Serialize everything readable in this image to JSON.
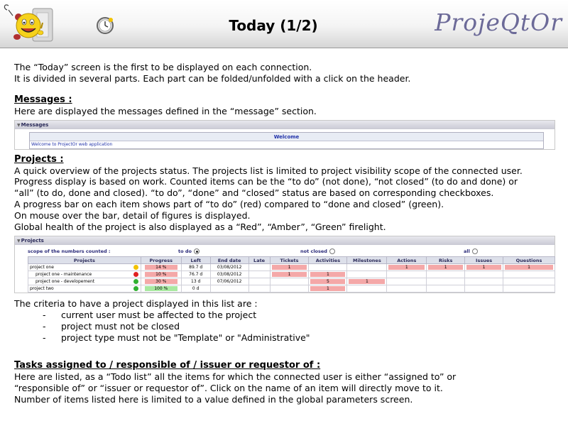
{
  "header": {
    "title": "Today (1/2)",
    "brand": "ProjeQtOr"
  },
  "intro": [
    "The “Today” screen is the first to be displayed on each connection.",
    "It is divided in several parts. Each part can be folded/unfolded with a click on the header."
  ],
  "messages": {
    "title": "Messages :",
    "text": "Here are displayed the messages defined in the “message” section.",
    "panel_header": "Messages",
    "table_header": "Welcome",
    "row": "Welcome to ProjectOr web application"
  },
  "projects": {
    "title": "Projects :",
    "lines": [
      "A quick overview of the projects status. The projects list is limited to project visibility scope of the connected user.",
      "Progress display is based on work. Counted items can be the “to do” (not done), “not closed” (to do and done) or",
      "“all” (to do, done and closed). “to do”, “done” and “closed” status are based on corresponding checkboxes.",
      "A progress bar on each item shows part of “to do” (red) compared to “done and closed” (green).",
      "On mouse over the bar, detail of figures is displayed.",
      "Global health of the project is also displayed as a “Red”, “Amber”, “Green” firelight."
    ],
    "panel_header": "Projects",
    "scope_label": "scope of the numbers counted :",
    "scope_options": [
      "to do",
      "not closed",
      "all"
    ],
    "scope_selected": "to do",
    "columns": [
      "Projects",
      "Progress",
      "Left",
      "End date",
      "Late",
      "Tickets",
      "Activities",
      "Milestones",
      "Actions",
      "Risks",
      "Issues",
      "Questions"
    ],
    "rows": [
      {
        "name": "project one",
        "indent": 0,
        "health": "#f2c200",
        "progress": "14 %",
        "progress_color": "pink",
        "left": "89.7 d",
        "end": "03/08/2012",
        "late": "",
        "tickets": "1",
        "activities": "",
        "milestones": "",
        "actions": "1",
        "risks": "1",
        "issues": "1",
        "questions": "1"
      },
      {
        "name": "project one - maintenance",
        "indent": 1,
        "health": "#e02020",
        "progress": "10 %",
        "progress_color": "pink",
        "left": "76.7 d",
        "end": "03/08/2012",
        "late": "",
        "tickets": "1",
        "activities": "1",
        "milestones": "",
        "actions": "",
        "risks": "",
        "issues": "",
        "questions": ""
      },
      {
        "name": "project one - developement",
        "indent": 1,
        "health": "#30b030",
        "progress": "30 %",
        "progress_color": "pink",
        "left": "13 d",
        "end": "07/06/2012",
        "late": "",
        "tickets": "",
        "activities": "5",
        "milestones": "1",
        "actions": "",
        "risks": "",
        "issues": "",
        "questions": ""
      },
      {
        "name": "project two",
        "indent": 0,
        "health": "#30b030",
        "progress": "100 %",
        "progress_color": "green",
        "left": "0 d",
        "end": "",
        "late": "",
        "tickets": "",
        "activities": "1",
        "milestones": "",
        "actions": "",
        "risks": "",
        "issues": "",
        "questions": ""
      }
    ]
  },
  "criteria": {
    "intro": "The criteria to have a project displayed in this list are :",
    "items": [
      "current user must be affected to the project",
      "project must not be closed",
      "project type must not be \"Template\" or \"Administrative\""
    ]
  },
  "tasks": {
    "title": "Tasks assigned to / responsible of / issuer or requestor of :",
    "lines": [
      "Here are listed, as a “Todo list” all the items for which the connected user is either “assigned to” or",
      "“responsible of” or “issuer or requestor of”. Click on the name of an item will directly move to it.",
      "Number of items listed here is limited to a value defined in the global parameters screen."
    ]
  },
  "icons": {
    "logo": "smiley-mascot-logo-icon",
    "clock": "clock-icon",
    "fold": "triangle-down-icon"
  }
}
